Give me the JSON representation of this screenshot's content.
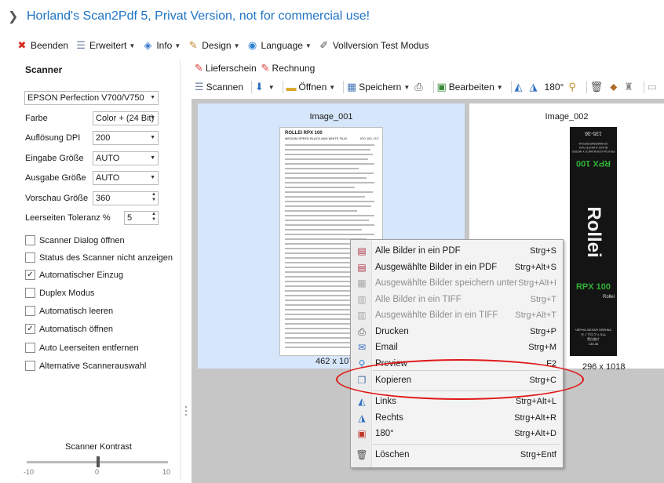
{
  "window": {
    "title": "Horland's Scan2Pdf 5, Privat Version, not for commercial use!"
  },
  "mainmenu": [
    {
      "label": "Beenden",
      "icon": "close-icon",
      "caret": false
    },
    {
      "label": "Erweitert",
      "icon": "tools-icon",
      "caret": true
    },
    {
      "label": "Info",
      "icon": "info-icon",
      "caret": true
    },
    {
      "label": "Design",
      "icon": "design-icon",
      "caret": true
    },
    {
      "label": "Language",
      "icon": "language-icon",
      "caret": true
    },
    {
      "label": "Vollversion Test Modus",
      "icon": "pen-icon",
      "caret": false
    }
  ],
  "scanner": {
    "header": "Scanner",
    "device": "EPSON Perfection V700/V750",
    "farbe_label": "Farbe",
    "farbe_value": "Color + (24 Bit)",
    "dpi_label": "Auflösung DPI",
    "dpi_value": "200",
    "eingabe_label": "Eingabe Größe",
    "eingabe_value": "AUTO",
    "ausgabe_label": "Ausgabe Größe",
    "ausgabe_value": "AUTO",
    "vorschau_label": "Vorschau Größe",
    "vorschau_value": "360",
    "toleranz_label": "Leerseiten Toleranz %",
    "toleranz_value": "5",
    "checkboxes": [
      {
        "label": "Scanner Dialog öffnen",
        "checked": false
      },
      {
        "label": "Status des Scanner nicht anzeigen",
        "checked": false
      },
      {
        "label": "Automatischer Einzug",
        "checked": true
      },
      {
        "label": "Duplex Modus",
        "checked": false
      },
      {
        "label": "Automatisch leeren",
        "checked": false
      },
      {
        "label": "Automatisch öffnen",
        "checked": true
      },
      {
        "label": "Auto Leerseiten entfernen",
        "checked": false
      },
      {
        "label": "Alternative Scannerauswahl",
        "checked": false
      }
    ],
    "kontrast_label": "Scanner Kontrast",
    "kontrast_min": "-10",
    "kontrast_mid": "0",
    "kontrast_max": "10",
    "kontrast_value": 0
  },
  "ribbon": {
    "lieferschein": "Lieferschein",
    "rechnung": "Rechnung"
  },
  "toolbar": {
    "scannen": "Scannen",
    "oeffnen": "Öffnen",
    "speichern": "Speichern",
    "bearbeiten": "Bearbeiten",
    "rotate_label": "180°"
  },
  "images": [
    {
      "name": "Image_001",
      "size": "462 x 1078"
    },
    {
      "name": "Image_002",
      "size": "296 x 1018"
    }
  ],
  "contextmenu": [
    {
      "label": "Alle Bilder in ein PDF",
      "shortcut": "Strg+S",
      "disabled": false,
      "icon": "pdf-icon"
    },
    {
      "label": "Ausgewählte Bilder in ein PDF",
      "shortcut": "Strg+Alt+S",
      "disabled": false,
      "icon": "pdf-icon"
    },
    {
      "label": "Ausgewählte Bilder speichern unter",
      "shortcut": "Strg+Alt+I",
      "disabled": true,
      "icon": "save-icon"
    },
    {
      "label": "Alle Bilder in ein TIFF",
      "shortcut": "Strg+T",
      "disabled": true,
      "icon": "tiff-icon"
    },
    {
      "label": "Ausgewählte Bilder in ein TIFF",
      "shortcut": "Strg+Alt+T",
      "disabled": true,
      "icon": "tiff-icon"
    },
    {
      "label": "Drucken",
      "shortcut": "Strg+P",
      "disabled": false,
      "icon": "printer-icon"
    },
    {
      "label": "Email",
      "shortcut": "Strg+M",
      "disabled": false,
      "icon": "email-icon"
    },
    {
      "label": "Preview",
      "shortcut": "F2",
      "disabled": false,
      "icon": "preview-icon"
    },
    {
      "label": "Kopieren",
      "shortcut": "Strg+C",
      "disabled": false,
      "icon": "copy-icon"
    },
    {
      "label": "Links",
      "shortcut": "Strg+Alt+L",
      "disabled": false,
      "icon": "rotate-left-icon"
    },
    {
      "label": "Rechts",
      "shortcut": "Strg+Alt+R",
      "disabled": false,
      "icon": "rotate-right-icon"
    },
    {
      "label": "180°",
      "shortcut": "Strg+Alt+D",
      "disabled": false,
      "icon": "rotate-180-icon"
    },
    {
      "label": "Löschen",
      "shortcut": "Strg+Entf",
      "disabled": false,
      "icon": "trash-icon"
    }
  ],
  "doc1": {
    "brand": "ROLLEI RPX 100",
    "sub": "MEDIUM SPEED BLACK AND WHITE FILM",
    "code": "ISO 100 / 21°"
  },
  "film": {
    "top": "135-36",
    "lang1": "PELÍCULA EN BLANCO Y NEGRO",
    "lang2": "BLACK & WHITE FILM",
    "lang3": "SCHWARZWEISSFILM",
    "rpx_top": "RPX 100",
    "rollei_big": "Rollei",
    "rpx_bottom": "RPX 100",
    "rollei_small": "Rollei",
    "bottom1": "ЧЁРНО-БЕЛАЯ ПЛЁНКА",
    "bottom2": "モノクロフィルム",
    "bottom3": "黑白胶片",
    "bottom4": "135-36"
  },
  "colors": {
    "title": "#1f74c4",
    "selection": "#d6e6fb",
    "oval": "#e01818",
    "film_green": "#2fb135"
  }
}
